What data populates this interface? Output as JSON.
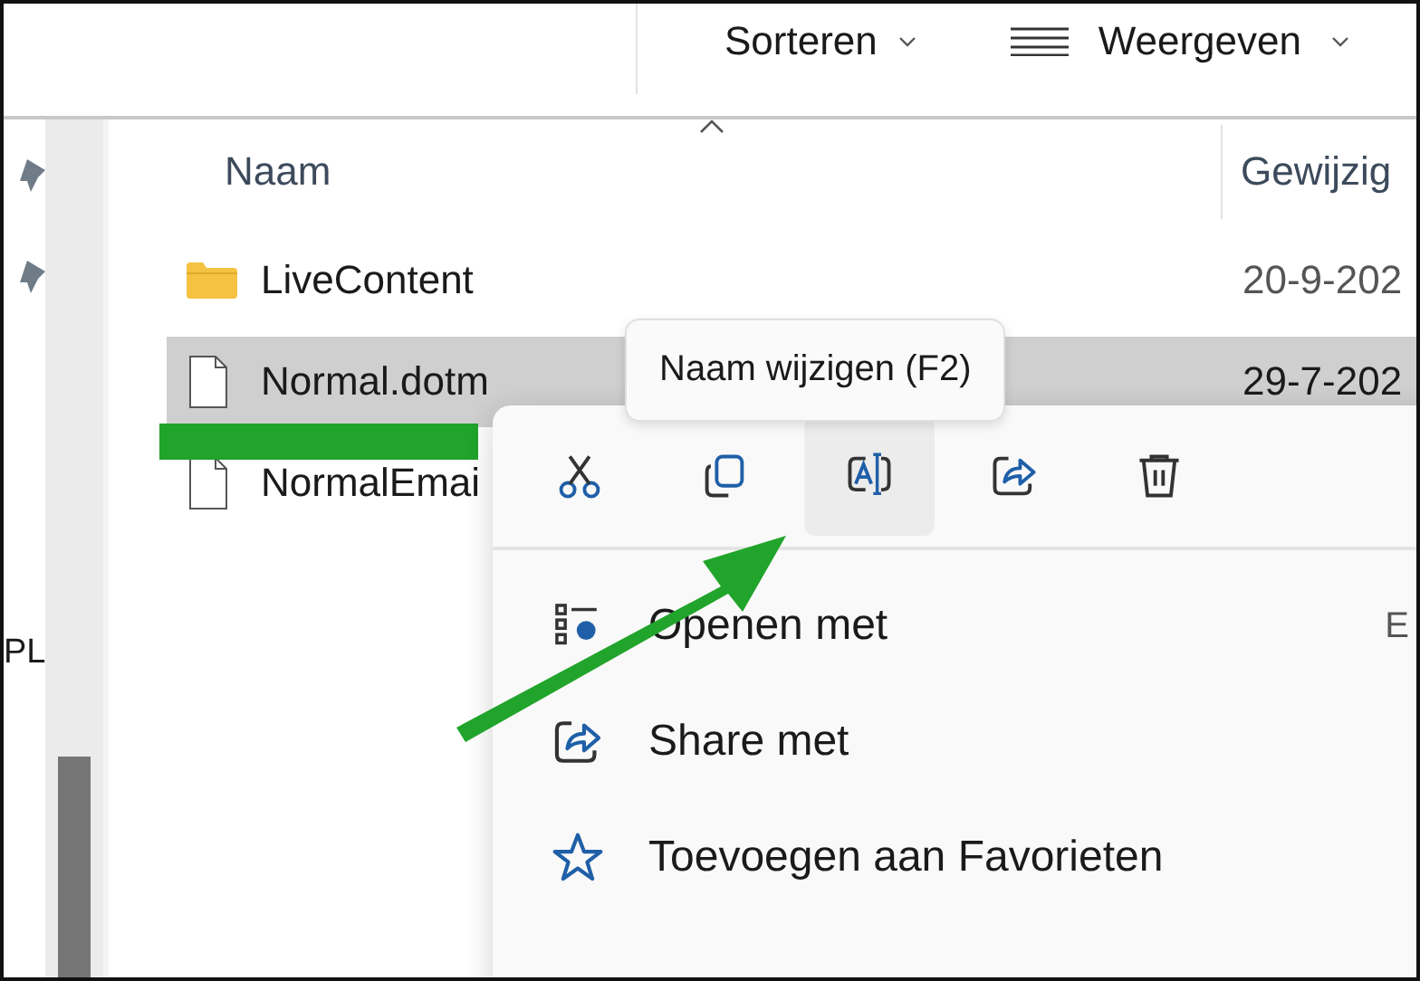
{
  "toolbar": {
    "sort_button": "Sorteren",
    "view_button": "Weergeven"
  },
  "sidebar": {
    "label": "PL"
  },
  "file_list": {
    "columns": [
      "Naam",
      "Gewijzig"
    ],
    "rows": [
      {
        "kind": "folder",
        "name": "LiveContent",
        "modified": "20-9-202",
        "selected": false
      },
      {
        "kind": "file",
        "name": "Normal.dotm",
        "modified": "29-7-202",
        "selected": true
      },
      {
        "kind": "file",
        "name": "NormalEmai",
        "selected": false
      }
    ]
  },
  "context_menu": {
    "tooltip": "Naam wijzigen (F2)",
    "actions": [
      {
        "kind": "cut",
        "hovered": false
      },
      {
        "kind": "copy",
        "hovered": false
      },
      {
        "kind": "rename",
        "hovered": true
      },
      {
        "kind": "share",
        "hovered": false
      },
      {
        "kind": "delete",
        "hovered": false
      }
    ],
    "items": [
      {
        "kind": "open-with",
        "label": "Openen met",
        "shortcut": "E"
      },
      {
        "kind": "share",
        "label": "Share met"
      },
      {
        "kind": "favorite",
        "label": "Toevoegen aan Favorieten"
      }
    ]
  }
}
